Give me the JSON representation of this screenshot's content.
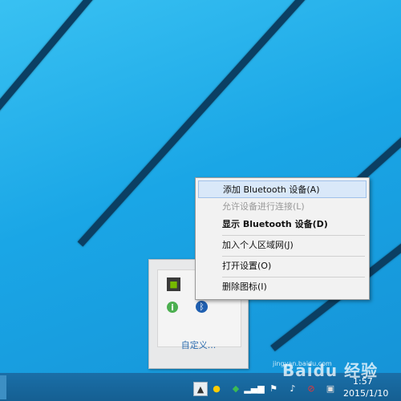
{
  "context_menu": {
    "items": [
      {
        "label": "添加 Bluetooth 设备(A)",
        "state": "highlighted"
      },
      {
        "label": "允许设备进行连接(L)",
        "state": "disabled"
      },
      {
        "label": "显示 Bluetooth 设备(D)",
        "state": "default-bold"
      },
      {
        "label": "加入个人区域网(J)",
        "state": "normal"
      },
      {
        "label": "打开设置(O)",
        "state": "normal"
      },
      {
        "label": "删除图标(I)",
        "state": "normal"
      }
    ]
  },
  "tray_popup": {
    "customize_label": "自定义...",
    "icons": [
      "nvidia-icon",
      "usb-device-icon",
      "info-icon",
      "bluetooth-icon"
    ]
  },
  "taskbar": {
    "clock_time": "1:57",
    "clock_date": "2015/1/10",
    "tray_icons": [
      "show-hidden-icons-chevron",
      "qq-icon",
      "security-icon",
      "network-signal-icon",
      "action-center-flag-icon",
      "volume-icon",
      "antivirus-icon",
      "app-icon"
    ]
  },
  "watermark": {
    "text": "Baidu 经验",
    "url": "jingyan.baidu.com"
  },
  "colors": {
    "desktop": "#1aa6e6",
    "taskbar": "#155f92",
    "menu_highlight": "#d9e8f9",
    "menu_bg": "#f2f2f2"
  }
}
